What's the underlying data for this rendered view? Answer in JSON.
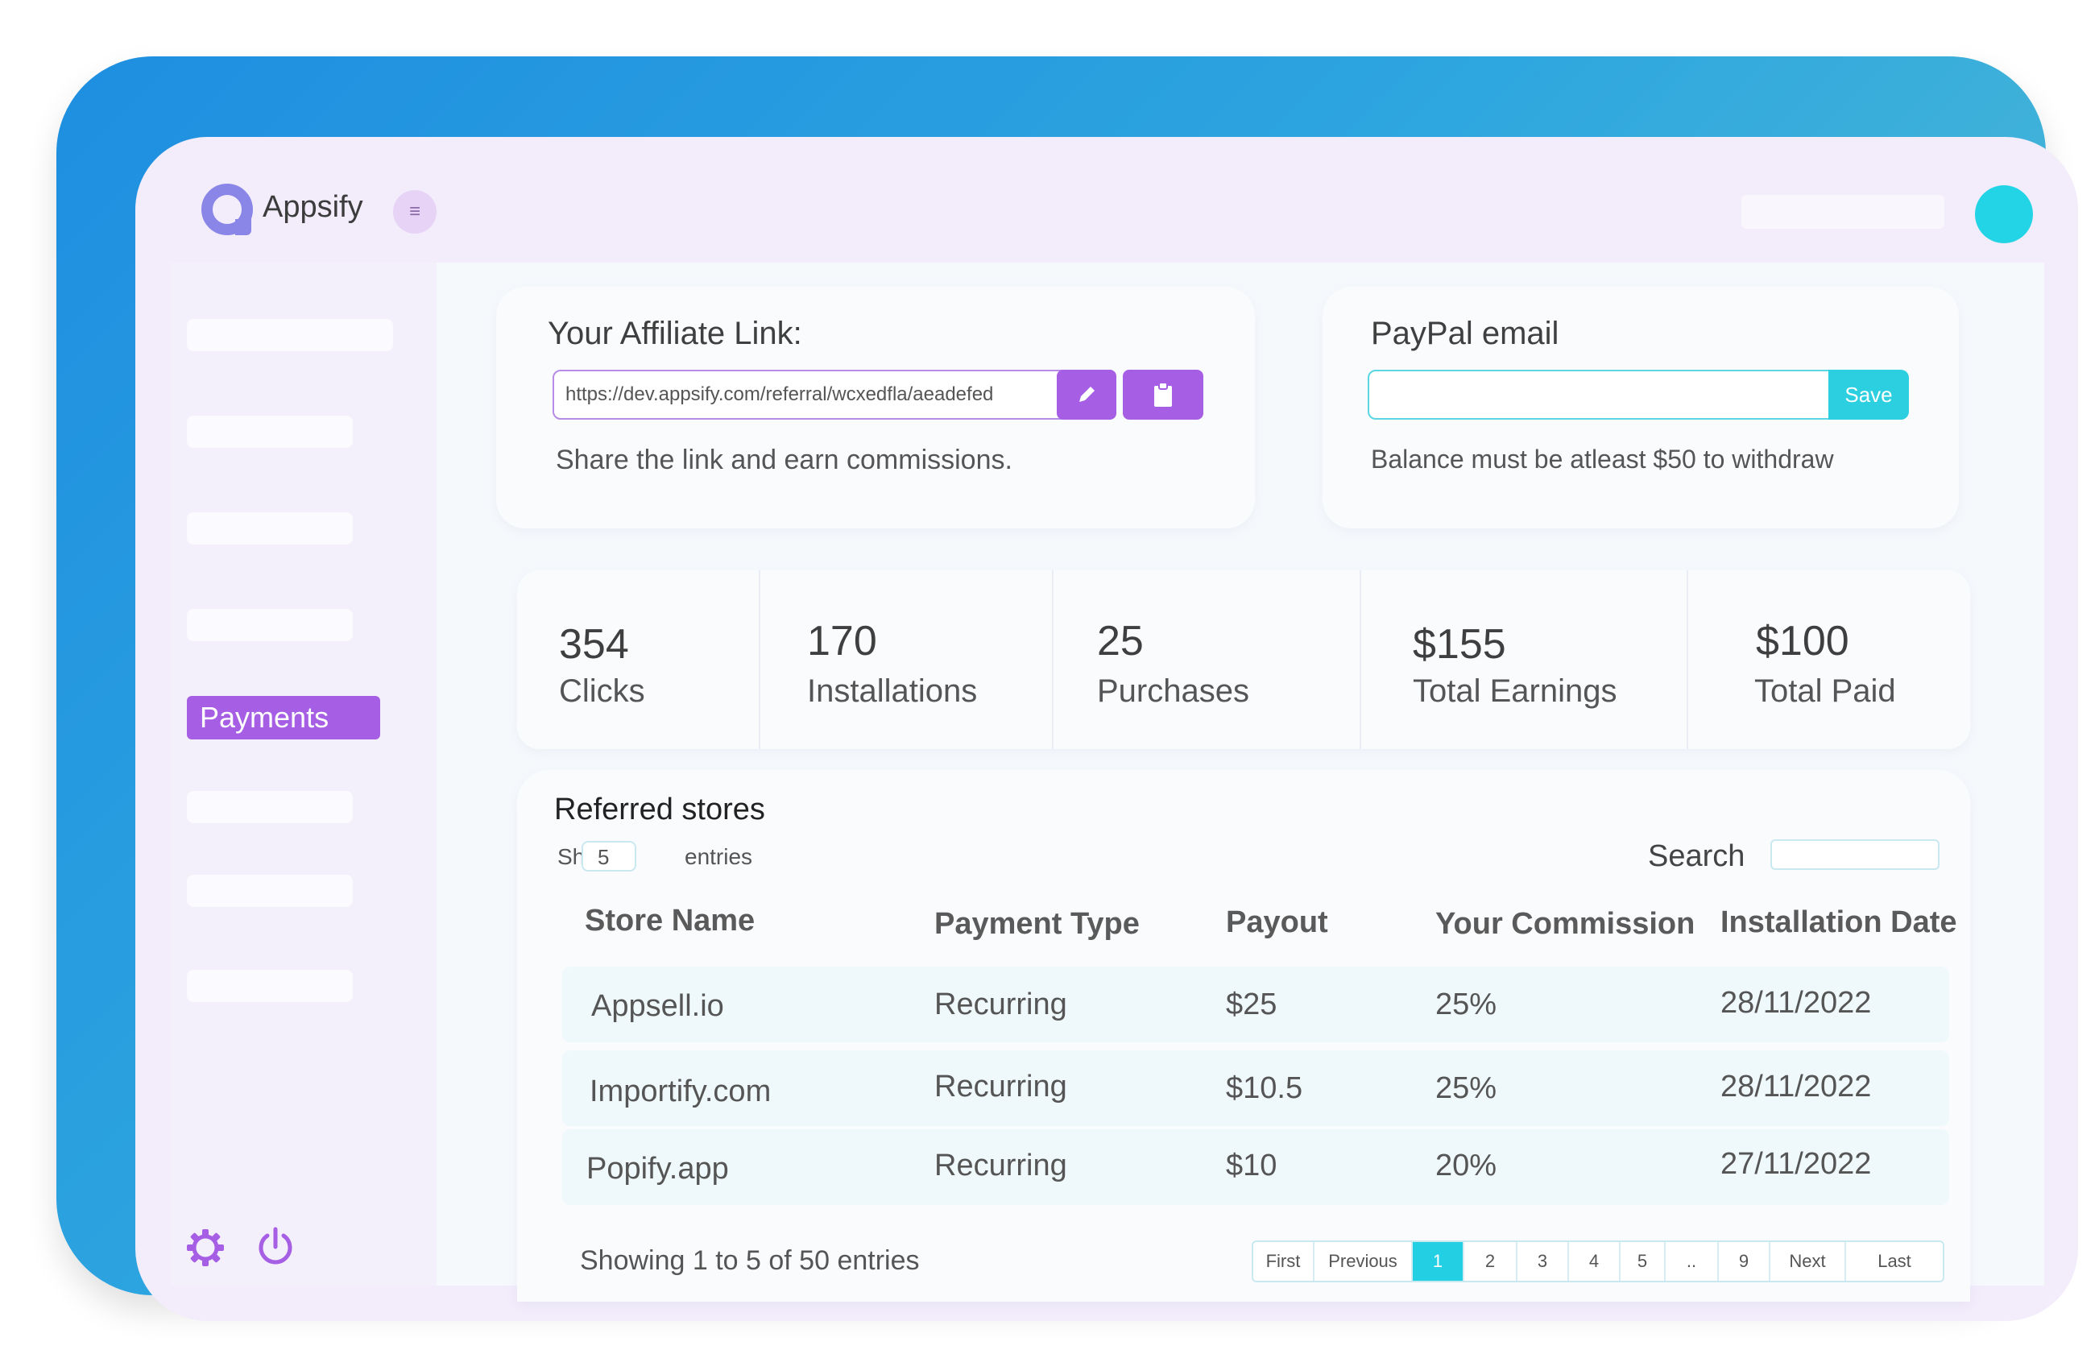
{
  "app": {
    "name": "Appsify"
  },
  "sidebar": {
    "active_item": "Payments"
  },
  "affiliate": {
    "title": "Your Affiliate Link:",
    "link": "https://dev.appsify.com/referral/wcxedfla/aeadefed",
    "helper": "Share the link and earn commissions."
  },
  "paypal": {
    "title": "PayPal email",
    "value": "",
    "save_label": "Save",
    "helper": "Balance must be atleast $50 to withdraw"
  },
  "stats": [
    {
      "value": "354",
      "label": "Clicks"
    },
    {
      "value": "170",
      "label": "Installations"
    },
    {
      "value": "25",
      "label": "Purchases"
    },
    {
      "value": "$155",
      "label": "Total Earnings"
    },
    {
      "value": "$100",
      "label": "Total Paid"
    }
  ],
  "table": {
    "title": "Referred stores",
    "show_label": "Show",
    "entries_value": "5",
    "entries_label": "entries",
    "search_label": "Search",
    "columns": [
      "Store Name",
      "Payment Type",
      "Payout",
      "Your Commission",
      "Installation Date"
    ],
    "rows": [
      [
        "Appsell.io",
        "Recurring",
        "$25",
        "25%",
        "28/11/2022"
      ],
      [
        "Importify.com",
        "Recurring",
        "$10.5",
        "25%",
        "28/11/2022"
      ],
      [
        "Popify.app",
        "Recurring",
        "$10",
        "20%",
        "27/11/2022"
      ]
    ],
    "showing_text": "Showing 1 to 5 of 50 entries",
    "pagination": [
      "First",
      "Previous",
      "1",
      "2",
      "3",
      "4",
      "5",
      "..",
      "9",
      "Next",
      "Last"
    ],
    "active_page": "1"
  },
  "colors": {
    "accent": "#a55ee4",
    "secondary": "#22cfe3"
  }
}
